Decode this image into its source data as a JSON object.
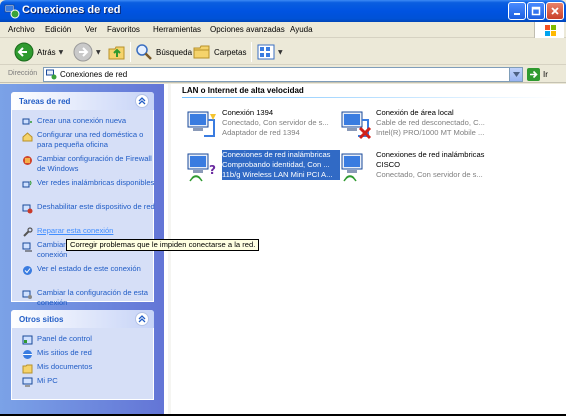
{
  "window": {
    "title": "Conexiones de red"
  },
  "menu": {
    "items": [
      "Archivo",
      "Edición",
      "Ver",
      "Favoritos",
      "Herramientas",
      "Opciones avanzadas",
      "Ayuda"
    ]
  },
  "toolbar": {
    "back_label": "Atrás",
    "search_label": "Búsqueda",
    "folders_label": "Carpetas"
  },
  "address": {
    "label": "Dirección",
    "value": "Conexiones de red",
    "go_label": "Ir"
  },
  "tasks_panel": {
    "title": "Tareas de red",
    "items": [
      {
        "label": "Crear una conexión nueva",
        "icon": "new-connection-icon"
      },
      {
        "label": "Configurar una red doméstica o para pequeña oficina",
        "icon": "home-network-icon"
      },
      {
        "label": "Cambiar configuración de Firewall de Windows",
        "icon": "firewall-icon"
      },
      {
        "label": "Ver redes inalámbricas disponibles",
        "icon": "wireless-icon"
      },
      {
        "label": "Deshabilitar este dispositivo de red",
        "icon": "disable-device-icon"
      },
      {
        "label": "Reparar esta conexión",
        "icon": "repair-icon"
      },
      {
        "label": "Cambiar el nombre de esta conexión",
        "icon": "rename-icon"
      },
      {
        "label": "Ver el estado de este conexión",
        "icon": "status-icon"
      },
      {
        "label": "Cambiar la configuración de esta conexión",
        "icon": "settings-icon"
      }
    ]
  },
  "places_panel": {
    "title": "Otros sitios",
    "items": [
      {
        "label": "Panel de control",
        "icon": "control-panel-icon"
      },
      {
        "label": "Mis sitios de red",
        "icon": "network-places-icon"
      },
      {
        "label": "Mis documentos",
        "icon": "documents-icon"
      },
      {
        "label": "Mi PC",
        "icon": "my-computer-icon"
      }
    ]
  },
  "tooltip": {
    "text": "Corregir problemas que le impiden conectarse a la red."
  },
  "main": {
    "group_title": "LAN o Internet de alta velocidad",
    "connections": [
      {
        "name": "Conexión 1394",
        "status": "Conectado, Con servidor de s...",
        "device": "Adaptador de red 1394",
        "selected": false,
        "icon": "lan-connected-icon"
      },
      {
        "name": "Conexión de área local",
        "status": "Cable de red desconectado, C...",
        "device": "Intel(R) PRO/1000 MT Mobile ...",
        "selected": false,
        "icon": "lan-disconnected-icon"
      },
      {
        "name": "Conexiones de red inalámbricas",
        "status": "Comprobando identidad, Con ...",
        "device": "11b/g Wireless LAN Mini PCI A...",
        "selected": true,
        "icon": "wireless-checking-icon"
      },
      {
        "name": "Conexiones de red inalámbricas",
        "status": "CISCO",
        "device": "Conectado, Con servidor de s...",
        "selected": false,
        "icon": "wireless-connected-icon"
      }
    ]
  }
}
